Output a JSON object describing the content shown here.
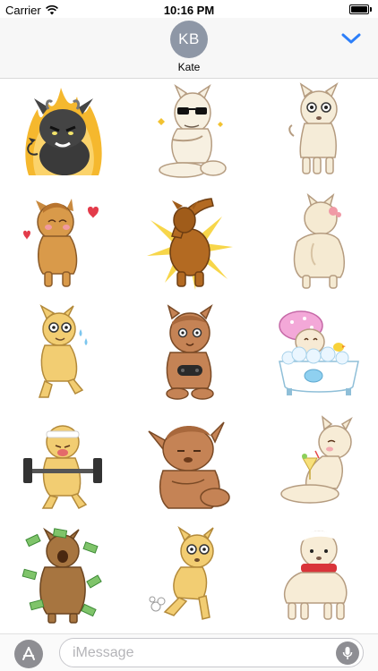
{
  "status_bar": {
    "carrier": "Carrier",
    "time": "10:16 PM",
    "battery_level": 1.0,
    "icons": [
      "wifi-icon",
      "battery-icon"
    ]
  },
  "header": {
    "avatar_initials": "KB",
    "contact_name": "Kate",
    "collapse_icon": "chevron-down-icon",
    "accent_color": "#2d7ff9"
  },
  "stickers": [
    {
      "id": "sticker-devil-alpaca",
      "icon": "devil-alpaca-on-fire"
    },
    {
      "id": "sticker-sunglasses-alpaca",
      "icon": "alpaca-with-sunglasses"
    },
    {
      "id": "sticker-surprised-alpaca",
      "icon": "surprised-alpaca"
    },
    {
      "id": "sticker-love-alpaca",
      "icon": "alpaca-with-hearts"
    },
    {
      "id": "sticker-dab-alpaca",
      "icon": "dabbing-alpaca"
    },
    {
      "id": "sticker-back-alpaca",
      "icon": "alpaca-from-behind"
    },
    {
      "id": "sticker-sweating-alpaca",
      "icon": "nervous-alpaca"
    },
    {
      "id": "sticker-gamer-alpaca",
      "icon": "alpaca-with-controller"
    },
    {
      "id": "sticker-bath-alpaca",
      "icon": "alpaca-in-bathtub"
    },
    {
      "id": "sticker-weightlifting-alpaca",
      "icon": "alpaca-lifting-barbell"
    },
    {
      "id": "sticker-lazy-alpaca",
      "icon": "sleepy-sitting-alpaca"
    },
    {
      "id": "sticker-cocktail-alpaca",
      "icon": "alpaca-with-cocktail"
    },
    {
      "id": "sticker-money-alpaca",
      "icon": "alpaca-with-money"
    },
    {
      "id": "sticker-running-alpaca",
      "icon": "running-alpaca"
    },
    {
      "id": "sticker-scarf-alpaca",
      "icon": "alpaca-with-scarf"
    }
  ],
  "input_bar": {
    "app_store_icon": "app-store-icon",
    "placeholder": "iMessage",
    "mic_icon": "microphone-icon"
  }
}
